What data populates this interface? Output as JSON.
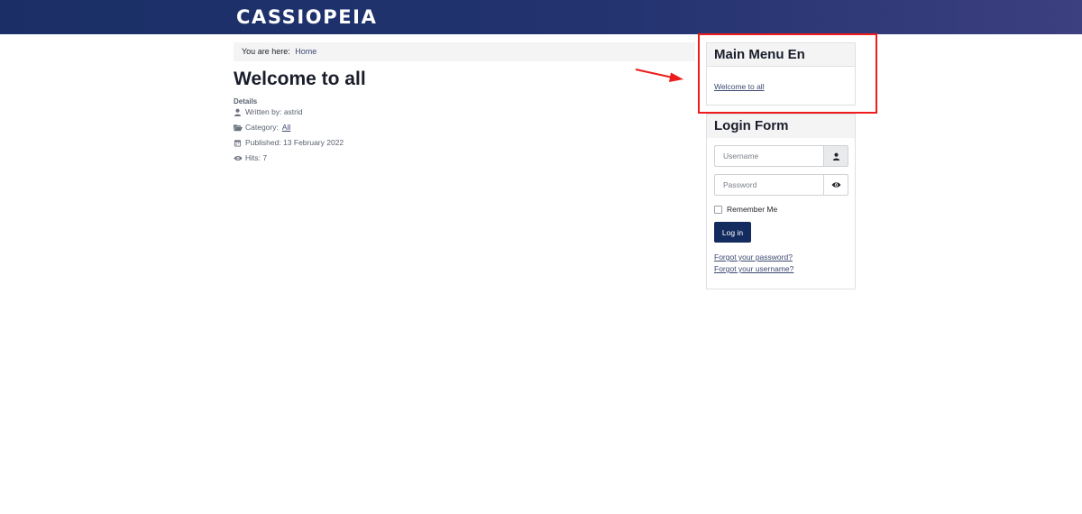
{
  "header": {
    "brand": "CASSIOPEIA"
  },
  "breadcrumb": {
    "prefix": "You are here:",
    "home": "Home"
  },
  "article": {
    "title": "Welcome to all",
    "details_label": "Details",
    "written_by": "Written by: astrid",
    "category_label": "Category:",
    "category_value": "All",
    "published": "Published: 13 February 2022",
    "hits": "Hits: 7"
  },
  "main_menu": {
    "title": "Main Menu En",
    "items": [
      {
        "label": "Welcome to all"
      }
    ]
  },
  "login_form": {
    "title": "Login Form",
    "username_placeholder": "Username",
    "password_placeholder": "Password",
    "remember_label": "Remember Me",
    "login_button": "Log in",
    "forgot_password": "Forgot your password?",
    "forgot_username": "Forgot your username?"
  },
  "annotation": {
    "highlight_color": "#ee1c1c"
  },
  "colors": {
    "header_gradient_start": "#1b2f66",
    "header_gradient_end": "#3c3f80",
    "button_bg": "#132b5e",
    "link": "#3d4a72"
  },
  "icons": {
    "written_by": "user-icon",
    "category": "folder-open-icon",
    "published": "calendar-icon",
    "hits": "eye-icon",
    "username_addon": "user-icon",
    "password_addon": "eye-icon"
  }
}
